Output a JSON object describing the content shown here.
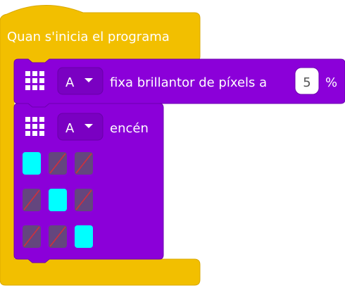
{
  "hat_block": {
    "label": "Quan s'inicia el programa",
    "color": "#F2BF00",
    "border": "#D9A800"
  },
  "block_brightness": {
    "icon": "pixel-grid-icon",
    "port": "A",
    "text": "fixa brillantor de píxels a",
    "value": "5",
    "unit": "%",
    "color": "#8B00D9",
    "border": "#6E00B0"
  },
  "block_on": {
    "icon": "pixel-grid-icon",
    "port": "A",
    "text": "encén",
    "color": "#8B00D9",
    "border": "#6E00B0",
    "matrix": [
      [
        1,
        0,
        0
      ],
      [
        0,
        1,
        0
      ],
      [
        0,
        0,
        1
      ]
    ],
    "pixel_on_color": "#00FFFF",
    "pixel_off_color": "#64467E",
    "pixel_off_slash_color": "#D0303C"
  }
}
